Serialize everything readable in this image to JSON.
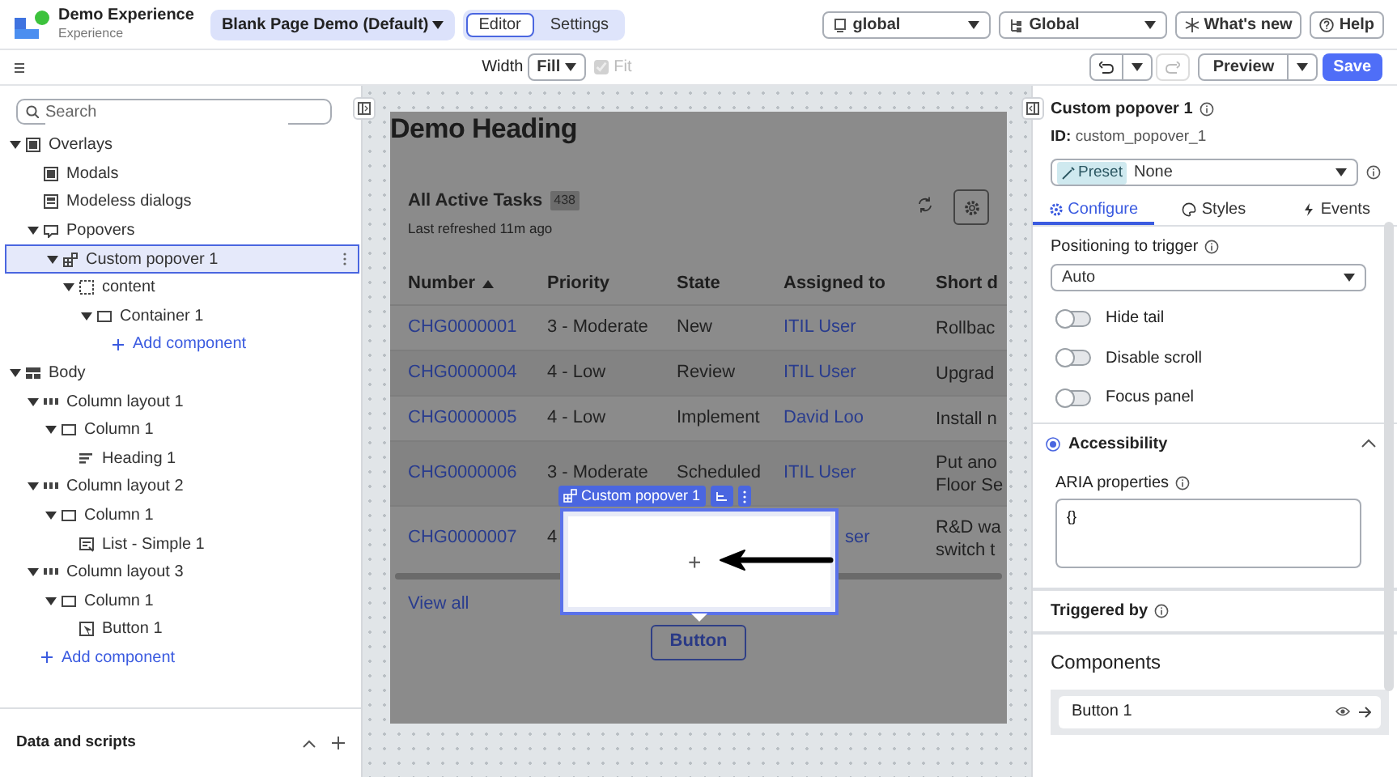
{
  "header": {
    "app_title": "Demo Experience",
    "app_subtitle": "Experience",
    "page_select": "Blank Page Demo (Default)",
    "mode_tabs": [
      {
        "label": "Editor",
        "selected": true
      },
      {
        "label": "Settings",
        "selected": false
      }
    ],
    "scope_select": "global",
    "domain_select": "Global",
    "buttons": [
      {
        "kind": "news",
        "label": "What's new"
      },
      {
        "kind": "help",
        "label": "Help"
      }
    ]
  },
  "toolbar": {
    "width_label": "Width",
    "width_select": "Fill",
    "fit": {
      "label": "Fit",
      "checked": true,
      "disabled": true
    },
    "preview": "Preview",
    "save": "Save"
  },
  "left_panel": {
    "search": {
      "placeholder": "Search"
    },
    "tree": [
      {
        "label": "Overlays",
        "kind": "overlay",
        "expanded": true,
        "selected": false,
        "children": [
          {
            "label": "Modals",
            "kind": "overlay",
            "selected": false
          },
          {
            "label": "Modeless dialogs",
            "kind": "dialog",
            "selected": false
          },
          {
            "label": "Popovers",
            "kind": "popover",
            "expanded": true,
            "selected": false,
            "children": [
              {
                "label": "Custom popover 1",
                "kind": "custom",
                "expanded": true,
                "selected": true,
                "children": [
                  {
                    "label": "content",
                    "kind": "slot",
                    "expanded": true,
                    "selected": false,
                    "children": [
                      {
                        "label": "Container 1",
                        "kind": "container",
                        "expanded": true,
                        "selected": false,
                        "children": [
                          {
                            "kind": "add",
                            "label": "Add component"
                          }
                        ]
                      }
                    ]
                  }
                ]
              }
            ]
          }
        ]
      },
      {
        "label": "Body",
        "kind": "layout",
        "expanded": true,
        "selected": false,
        "children": [
          {
            "label": "Column layout 1",
            "kind": "columns",
            "expanded": true,
            "selected": false,
            "children": [
              {
                "label": "Column 1",
                "kind": "container",
                "expanded": true,
                "selected": false,
                "children": [
                  {
                    "label": "Heading 1",
                    "kind": "heading",
                    "selected": false
                  }
                ]
              }
            ]
          },
          {
            "label": "Column layout 2",
            "kind": "columns",
            "expanded": true,
            "selected": false,
            "children": [
              {
                "label": "Column 1",
                "kind": "container",
                "expanded": true,
                "selected": false,
                "children": [
                  {
                    "label": "List - Simple 1",
                    "kind": "list",
                    "selected": false
                  }
                ]
              }
            ]
          },
          {
            "label": "Column layout 3",
            "kind": "columns",
            "expanded": true,
            "selected": false,
            "children": [
              {
                "label": "Column 1",
                "kind": "container",
                "expanded": true,
                "selected": false,
                "children": [
                  {
                    "label": "Button 1",
                    "kind": "button",
                    "selected": false
                  }
                ]
              }
            ]
          },
          {
            "kind": "add",
            "label": "Add component"
          }
        ]
      }
    ],
    "footer": "Data and scripts"
  },
  "canvas": {
    "heading": "Demo Heading",
    "list_title": "All Active Tasks",
    "count": "438",
    "refreshed": "Last refreshed 11m ago",
    "columns": [
      {
        "label": "Number",
        "kind": "link",
        "sorted": true
      },
      {
        "label": "Priority",
        "kind": "text",
        "sorted": false
      },
      {
        "label": "State",
        "kind": "text",
        "sorted": false
      },
      {
        "label": "Assigned to",
        "kind": "link",
        "sorted": false
      },
      {
        "label": "Short d",
        "kind": "text",
        "sorted": false
      }
    ],
    "rows": [
      {
        "cells": [
          "CHG0000001",
          "3 - Moderate",
          "New",
          "ITIL User",
          "Rollbac"
        ]
      },
      {
        "cells": [
          "CHG0000004",
          "4 - Low",
          "Review",
          "ITIL User",
          "Upgrad"
        ]
      },
      {
        "cells": [
          "CHG0000005",
          "4 - Low",
          "Implement",
          "David Loo",
          "Install n"
        ]
      },
      {
        "cells": [
          "CHG0000006",
          "3 - Moderate",
          "Scheduled",
          "ITIL User",
          "Put ano\nFloor Se"
        ]
      },
      {
        "cells": [
          "CHG0000007",
          "4",
          null,
          "ser",
          "R&D wa\nswitch t"
        ]
      }
    ],
    "view_all": "View all",
    "button": "Button",
    "popover_label": "Custom popover 1",
    "popover_add": "+"
  },
  "right_panel": {
    "title": "Custom popover 1",
    "id_label": "ID:",
    "id_value": "custom_popover_1",
    "preset_chip": "Preset",
    "preset_value": "None",
    "tabs": [
      {
        "label": "Configure",
        "kind": "gear",
        "selected": true
      },
      {
        "label": "Styles",
        "kind": "palette",
        "selected": false
      },
      {
        "label": "Events",
        "kind": "bolt",
        "selected": false
      }
    ],
    "positioning_label": "Positioning to trigger",
    "positioning_value": "Auto",
    "toggles": [
      {
        "label": "Hide tail",
        "on": false
      },
      {
        "label": "Disable scroll",
        "on": false
      },
      {
        "label": "Focus panel",
        "on": false
      }
    ],
    "accessibility": {
      "title": "Accessibility",
      "expanded": true,
      "aria_label": "ARIA properties",
      "aria_value": "{}"
    },
    "triggered_by": "Triggered by",
    "components_title": "Components",
    "components": [
      "Button 1"
    ]
  }
}
